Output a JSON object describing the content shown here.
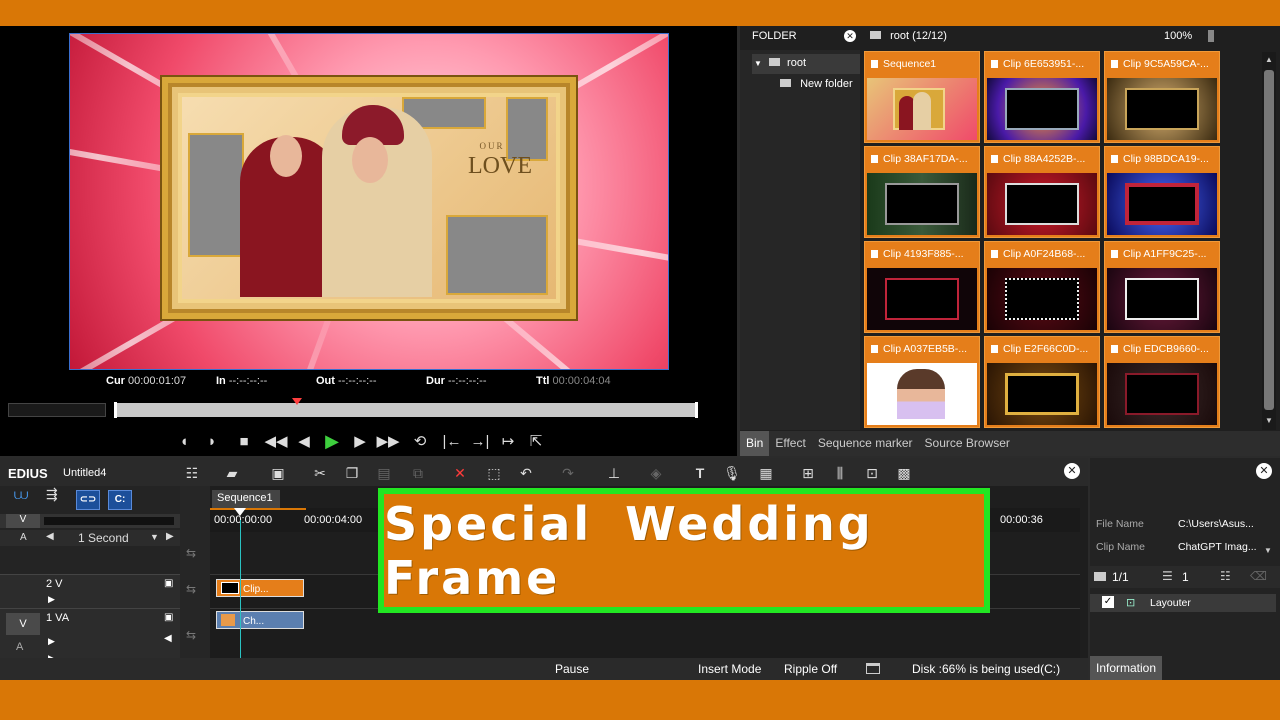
{
  "colors": {
    "accent": "#d97706",
    "banner_border": "#22e622",
    "play": "#3ecf3e",
    "delete": "#ff3b3b",
    "playhead": "#2ac2c2"
  },
  "preview": {
    "frame_text_top": "OUR",
    "frame_text_main": "LOVE",
    "timecodes": {
      "cur_label": "Cur",
      "cur_value": "00:00:01:07",
      "in_label": "In",
      "in_value": "--:--:--:--",
      "out_label": "Out",
      "out_value": "--:--:--:--",
      "dur_label": "Dur",
      "dur_value": "--:--:--:--",
      "ttl_label": "Ttl",
      "ttl_value": "00:00:04:04"
    },
    "transport_icons": [
      "mark-in-icon",
      "mark-out-icon",
      "stop-icon",
      "rewind-icon",
      "step-back-icon",
      "play-icon",
      "step-forward-icon",
      "fast-forward-icon",
      "loop-icon",
      "go-to-in-icon",
      "go-to-out-icon",
      "insert-to-timeline-icon",
      "export-icon"
    ]
  },
  "bin": {
    "folder_label": "FOLDER",
    "tree_root": "root",
    "tree_new_folder": "New folder",
    "path": "root (12/12)",
    "zoom": "100%",
    "clips": [
      {
        "name": "Sequence1",
        "kind": "seq"
      },
      {
        "name": "Clip 6E653951-...",
        "kind": "a"
      },
      {
        "name": "Clip 9C5A59CA-...",
        "kind": "b"
      },
      {
        "name": "Clip 38AF17DA-...",
        "kind": "c"
      },
      {
        "name": "Clip 88A4252B-...",
        "kind": "d"
      },
      {
        "name": "Clip 98BDCA19-...",
        "kind": "e"
      },
      {
        "name": "Clip 4193F885-...",
        "kind": "f"
      },
      {
        "name": "Clip A0F24B68-...",
        "kind": "g"
      },
      {
        "name": "Clip A1FF9C25-...",
        "kind": "h"
      },
      {
        "name": "Clip A037EB5B-...",
        "kind": "i"
      },
      {
        "name": "Clip E2F66C0D-...",
        "kind": "j"
      },
      {
        "name": "Clip EDCB9660-...",
        "kind": "k"
      }
    ],
    "tabs": [
      "Bin",
      "Effect",
      "Sequence marker",
      "Source Browser"
    ]
  },
  "timeline": {
    "app_name": "EDIUS",
    "project": "Untitled4",
    "sequence_tab": "Sequence1",
    "scale": "1 Second",
    "ruler": [
      "00:00:00:00",
      "00:00:04:00",
      "00:00:36"
    ],
    "tracks": {
      "v_label": "V",
      "a_label": "A",
      "track2": "2 V",
      "track1": "1 VA",
      "track1_btn": "V",
      "audio_sub": "A"
    },
    "clips": {
      "v2": "Clip...",
      "va1": "Ch..."
    }
  },
  "info": {
    "file_name_label": "File Name",
    "file_name_value": "C:\\Users\\Asus...",
    "clip_name_label": "Clip Name",
    "clip_name_value": "ChatGPT Imag...",
    "page": "1/1",
    "count": "1",
    "effect": "Layouter",
    "tab": "Information"
  },
  "status": {
    "state": "Pause",
    "mode": "Insert Mode",
    "ripple": "Ripple Off",
    "disk": "Disk :66% is being used(C:)"
  },
  "banner": {
    "text": "Special Wedding Frame"
  }
}
